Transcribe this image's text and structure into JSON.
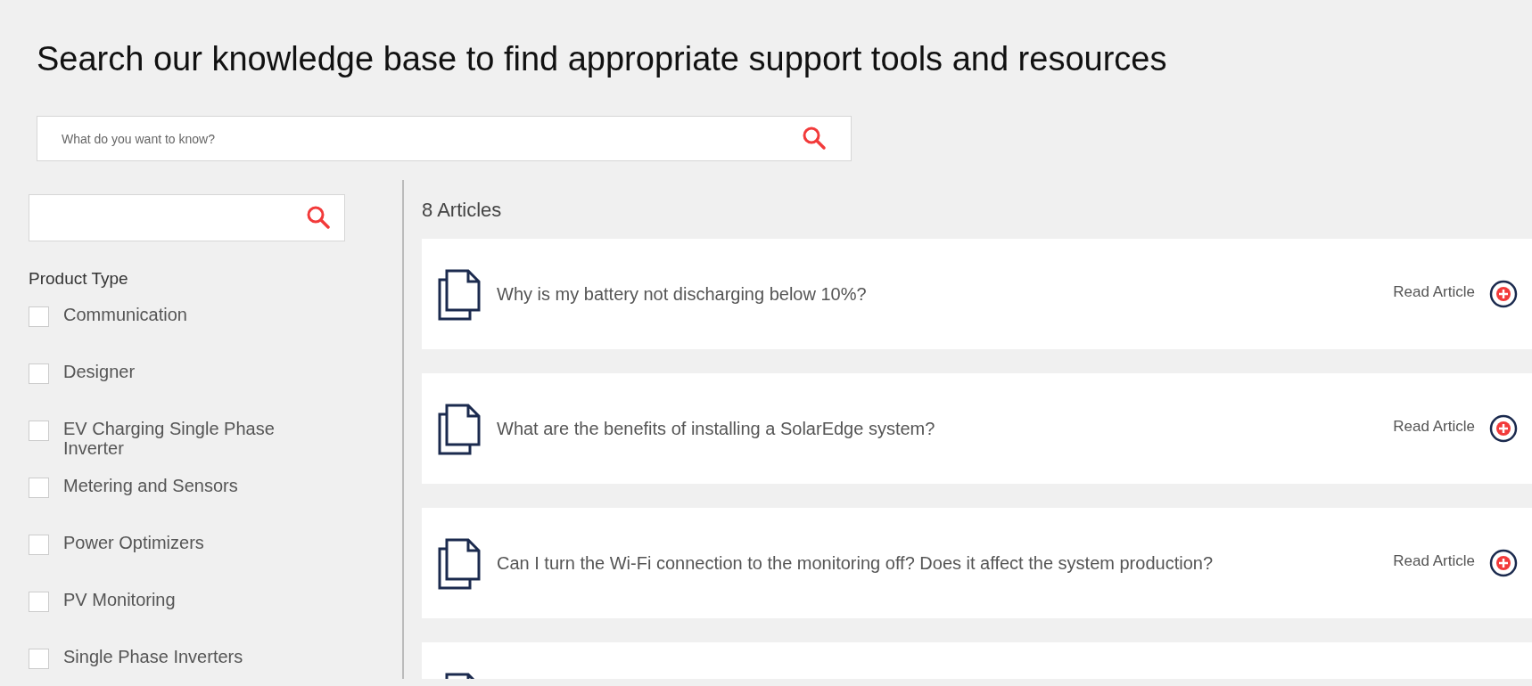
{
  "heading": "Search our knowledge base to find appropriate support tools and resources",
  "search": {
    "placeholder": "What do you want to know?"
  },
  "filters": {
    "title": "Product Type",
    "items": [
      {
        "label": "Communication",
        "checked": false
      },
      {
        "label": "Designer",
        "checked": false
      },
      {
        "label": "EV Charging Single Phase Inverter",
        "checked": false
      },
      {
        "label": "Metering and Sensors",
        "checked": false
      },
      {
        "label": "Power Optimizers",
        "checked": false
      },
      {
        "label": "PV Monitoring",
        "checked": false
      },
      {
        "label": "Single Phase Inverters",
        "checked": false
      }
    ]
  },
  "results": {
    "count": "8 Articles",
    "articles": [
      {
        "title": "Why is my battery not discharging below 10%?",
        "action": "Read Article"
      },
      {
        "title": "What are the benefits of installing a SolarEdge system?",
        "action": "Read Article"
      },
      {
        "title": "Can I turn the Wi-Fi connection to the monitoring off? Does it affect the system production?",
        "action": "Read Article"
      }
    ]
  }
}
